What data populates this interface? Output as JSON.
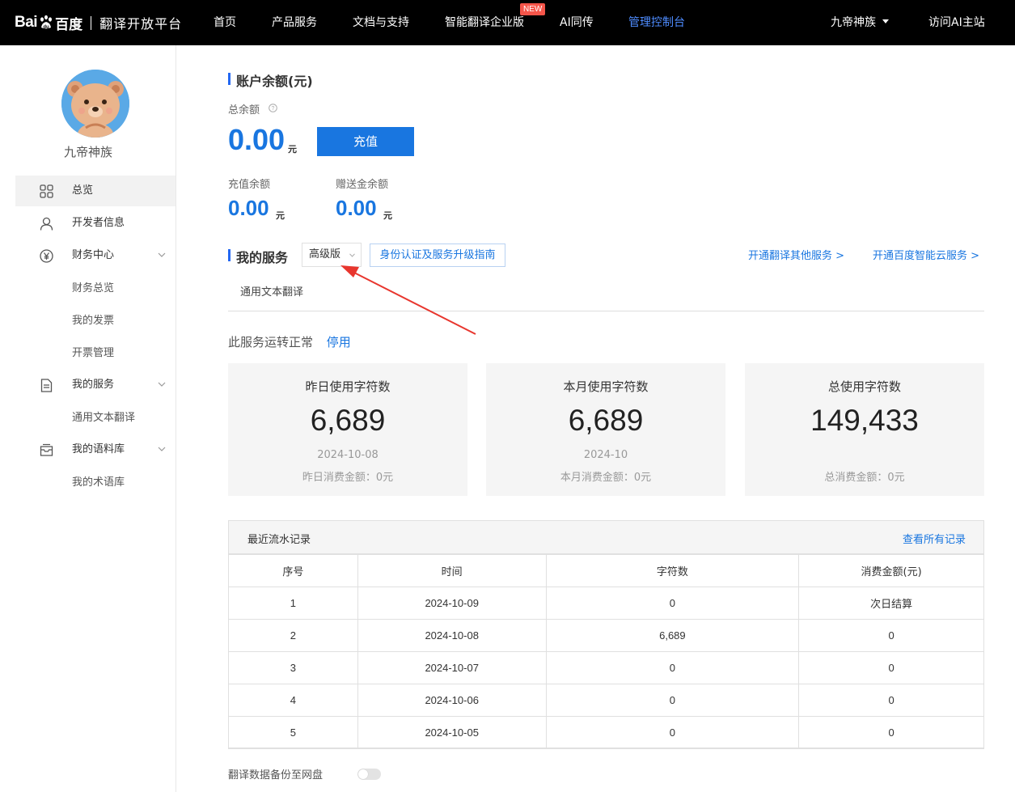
{
  "nav": {
    "logo_text": "Bai",
    "logo_brand": "百度",
    "platform": "翻译开放平台",
    "items": [
      {
        "label": "首页"
      },
      {
        "label": "产品服务"
      },
      {
        "label": "文档与支持"
      },
      {
        "label": "智能翻译企业版",
        "badge": "NEW"
      },
      {
        "label": "AI同传"
      },
      {
        "label": "管理控制台",
        "active": true
      }
    ],
    "user": "九帝神族",
    "visit": "访问AI主站"
  },
  "sidebar": {
    "user_name": "九帝神族",
    "menu": [
      {
        "label": "总览",
        "icon": "grid-icon",
        "active": true
      },
      {
        "label": "开发者信息",
        "icon": "user-icon"
      },
      {
        "label": "财务中心",
        "icon": "yen-icon"
      },
      {
        "label": "财务总览"
      },
      {
        "label": "我的发票"
      },
      {
        "label": "开票管理"
      },
      {
        "label": "我的服务",
        "icon": "document-icon"
      },
      {
        "label": "通用文本翻译"
      },
      {
        "label": "我的语料库",
        "icon": "inbox-icon"
      },
      {
        "label": "我的术语库"
      }
    ]
  },
  "balance": {
    "title": "账户余额(元)",
    "total_label": "总余额",
    "total_value": "0.00",
    "unit": "元",
    "recharge_btn": "充值",
    "recharge_label": "充值余额",
    "recharge_value": "0.00",
    "gift_label": "赠送金余额",
    "gift_value": "0.00"
  },
  "service": {
    "title": "我的服务",
    "edition": "高级版",
    "guide": "身份认证及服务升级指南",
    "link_other": "开通翻译其他服务 >",
    "link_cloud": "开通百度智能云服务 >",
    "tab": "通用文本翻译",
    "status": "此服务运转正常",
    "stop": "停用"
  },
  "stats": [
    {
      "title": "昨日使用字符数",
      "value": "6,689",
      "date": "2024-10-08",
      "cost": "昨日消费金额：0元"
    },
    {
      "title": "本月使用字符数",
      "value": "6,689",
      "date": "2024-10",
      "cost": "本月消费金额：0元"
    },
    {
      "title": "总使用字符数",
      "value": "149,433",
      "date": "",
      "cost": "总消费金额：0元"
    }
  ],
  "records": {
    "title": "最近流水记录",
    "view_all": "查看所有记录",
    "headers": [
      "序号",
      "时间",
      "字符数",
      "消费金额(元)"
    ],
    "rows": [
      [
        "1",
        "2024-10-09",
        "0",
        "次日结算"
      ],
      [
        "2",
        "2024-10-08",
        "6,689",
        "0"
      ],
      [
        "3",
        "2024-10-07",
        "0",
        "0"
      ],
      [
        "4",
        "2024-10-06",
        "0",
        "0"
      ],
      [
        "5",
        "2024-10-05",
        "0",
        "0"
      ]
    ]
  },
  "backup": {
    "label": "翻译数据备份至网盘",
    "enabled": false
  },
  "colors": {
    "accent": "#1976e0",
    "nav_bg": "#000000",
    "new_badge": "#f5554a",
    "arrow": "#e8362e"
  }
}
